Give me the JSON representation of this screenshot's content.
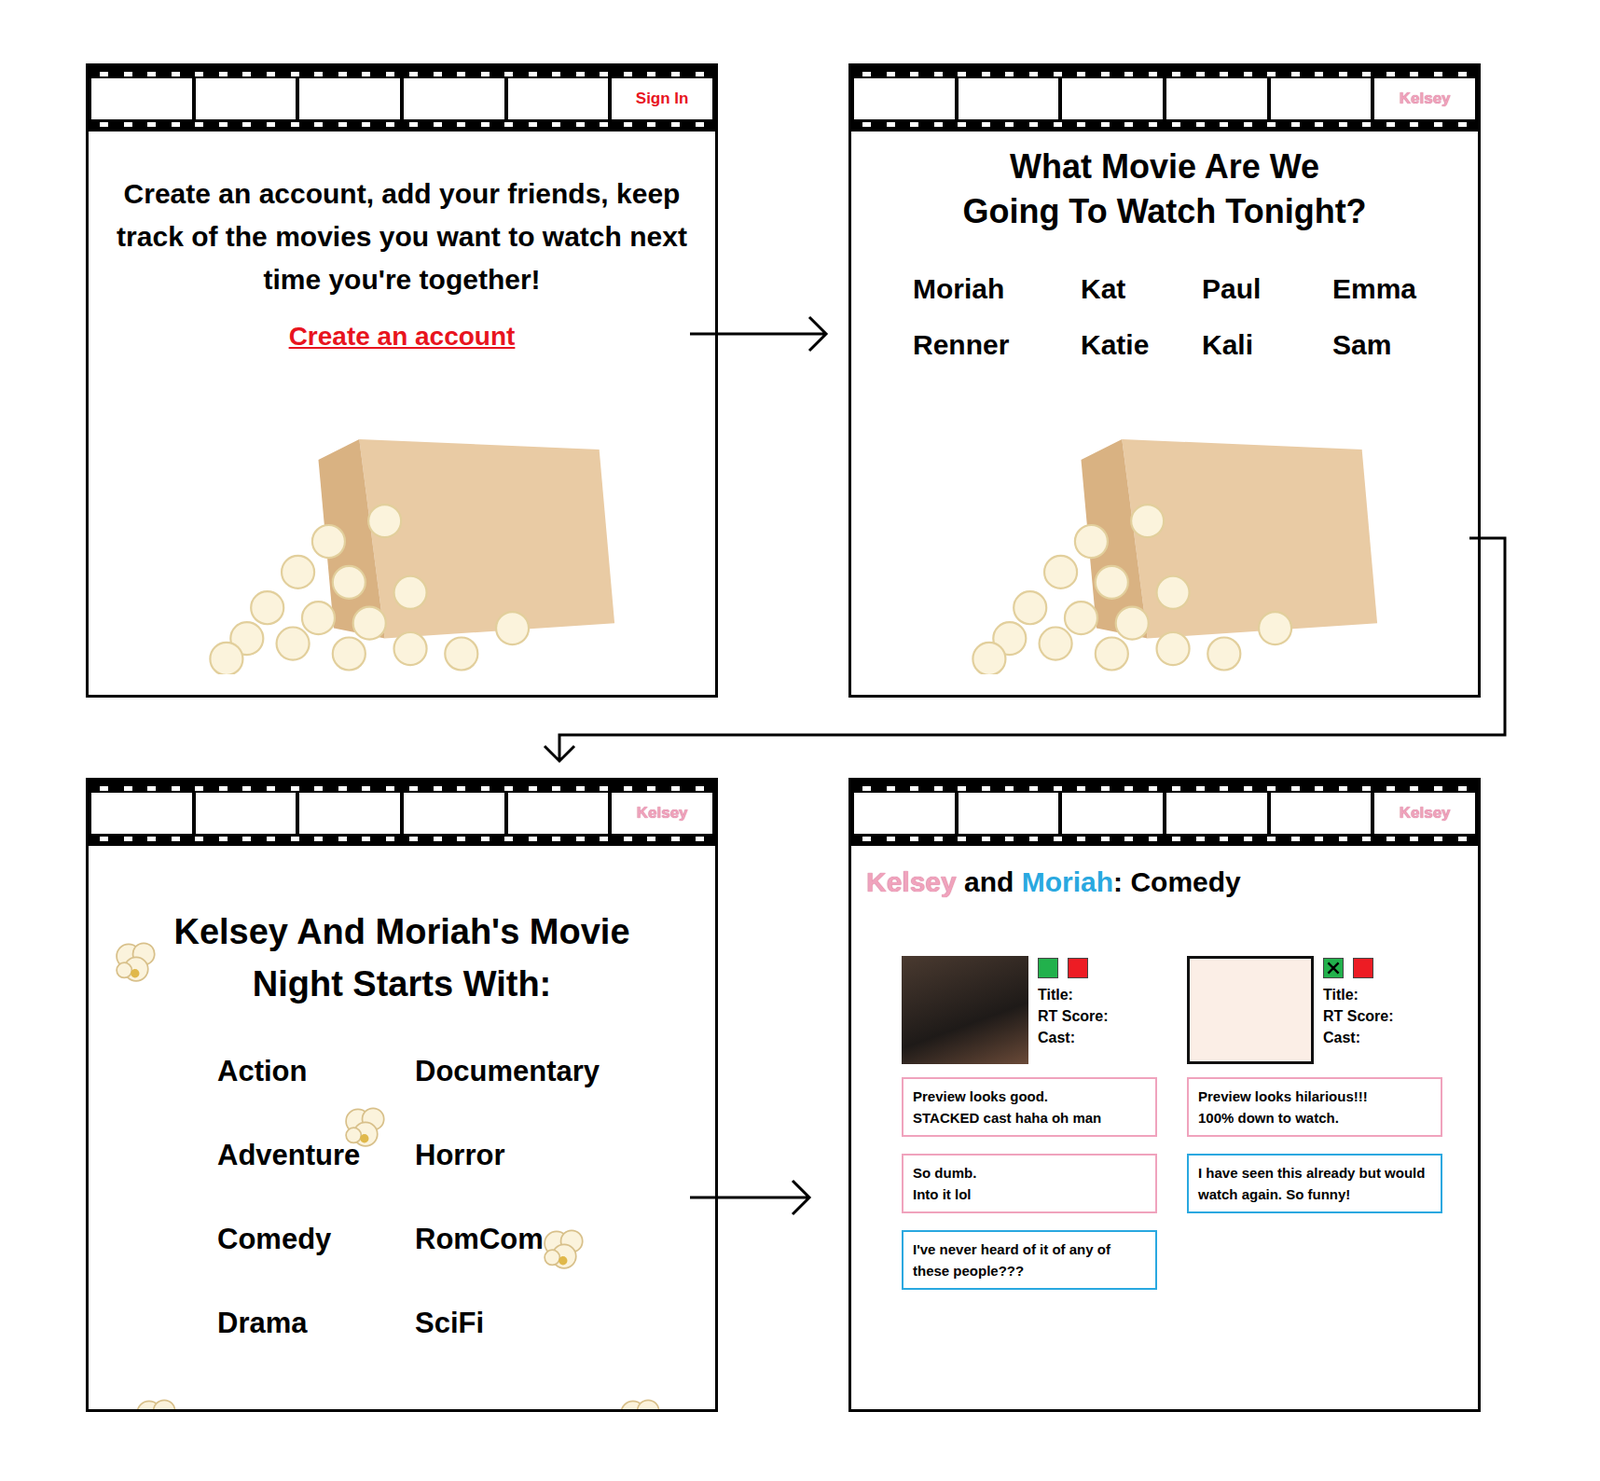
{
  "screens": [
    {
      "kind": "landing",
      "header_label": {
        "text": "Sign In",
        "color": "#e8141e"
      },
      "text": "Create an account, add your friends, keep track of the movies you want to watch next time you're together!",
      "link": "Create an account"
    },
    {
      "kind": "friends",
      "header_label": {
        "text": "Kelsey",
        "color": "#f0a3bd"
      },
      "title": "What Movie Are We Going To Watch Tonight?",
      "friends": [
        "Moriah",
        "Kat",
        "Paul",
        "Emma",
        "Renner",
        "Katie",
        "Kali",
        "Sam"
      ]
    },
    {
      "kind": "genres",
      "header_label": {
        "text": "Kelsey",
        "color": "#f0a3bd"
      },
      "title": "Kelsey And Moriah's Movie Night Starts With:",
      "genres": [
        "Action",
        "Documentary",
        "Adventure",
        "Horror",
        "Comedy",
        "RomCom",
        "Drama",
        "SciFi"
      ]
    },
    {
      "kind": "movies",
      "header_label": {
        "text": "Kelsey",
        "color": "#f0a3bd"
      },
      "heading": [
        {
          "text": "Kelsey",
          "color": "#f0a3bd"
        },
        {
          "text": " and ",
          "color": "#000000"
        },
        {
          "text": "Moriah",
          "color": "#29a8e0"
        },
        {
          "text": ": Comedy",
          "color": "#000000"
        }
      ],
      "movies": [
        {
          "poster": "dark",
          "votes": [
            {
              "color": "#22b14c",
              "checked": false
            },
            {
              "color": "#ed1c24",
              "checked": false
            }
          ],
          "fields": [
            "Title:",
            "RT Score:",
            "Cast:"
          ],
          "comments": [
            {
              "text": "Preview looks good.\nSTACKED cast haha oh man",
              "color": "#f0a3bd"
            },
            {
              "text": "So dumb.\nInto it lol",
              "color": "#f0a3bd"
            },
            {
              "text": "I've never heard of it of any of these people???",
              "color": "#29a8e0"
            }
          ]
        },
        {
          "poster": "light",
          "votes": [
            {
              "color": "#22b14c",
              "checked": true
            },
            {
              "color": "#ed1c24",
              "checked": false
            }
          ],
          "fields": [
            "Title:",
            "RT Score:",
            "Cast:"
          ],
          "comments": [
            {
              "text": "Preview looks hilarious!!!\n100% down to watch.",
              "color": "#f0a3bd"
            },
            {
              "text": "I have seen this already but would watch again. So funny!",
              "color": "#29a8e0"
            }
          ]
        }
      ]
    }
  ]
}
